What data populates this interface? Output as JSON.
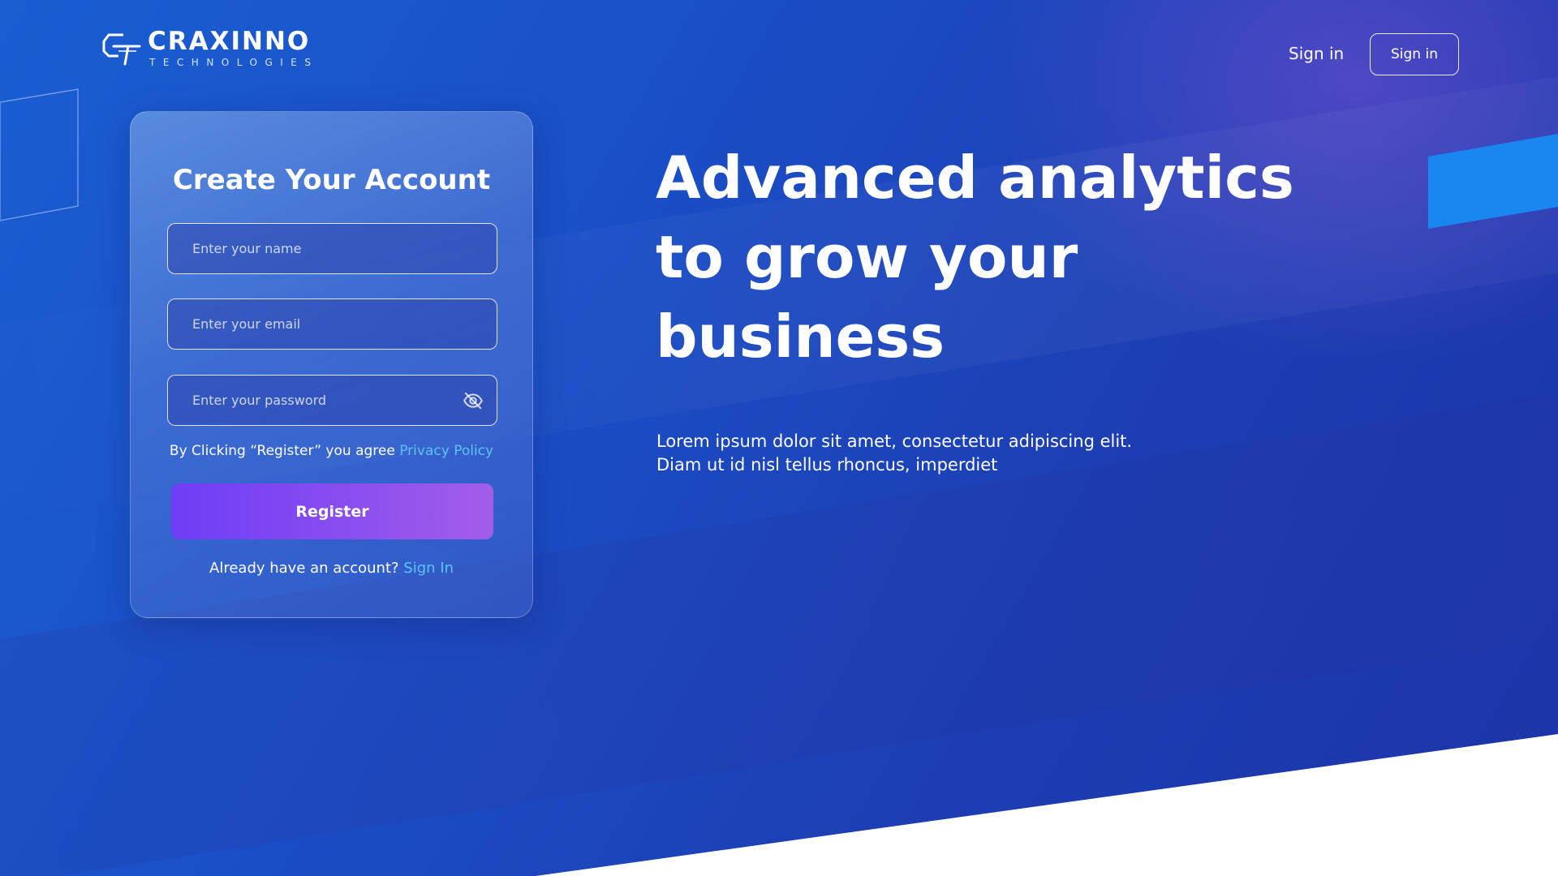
{
  "brand": {
    "name": "CRAXINNO",
    "tagline": "TECHNOLOGIES",
    "icon": "ct-logo-icon"
  },
  "nav": {
    "signin_link": "Sign in",
    "signin_button": "Sign in"
  },
  "form": {
    "title": "Create Your Account",
    "name_placeholder": "Enter your name",
    "email_placeholder": "Enter your email",
    "password_placeholder": "Enter your password",
    "password_toggle_icon": "eye-off-icon",
    "terms_prefix": "By Clicking “Register” you agree ",
    "terms_link": "Privacy Policy",
    "register_label": "Register",
    "account_prefix": "Already have an account? ",
    "account_link": "Sign In"
  },
  "hero": {
    "title_lines": [
      "Advanced analytics",
      "to grow your",
      "business"
    ],
    "description_lines": [
      "Lorem ipsum dolor sit amet, consectetur adipiscing elit.",
      "Diam ut id nisl tellus rhoncus, imperdiet"
    ]
  },
  "colors": {
    "background_start": "#1a5ed2",
    "background_end": "#1c34a8",
    "register_start": "#6e3df5",
    "register_end": "#a35ee8",
    "link_accent": "#5ec3ff"
  }
}
